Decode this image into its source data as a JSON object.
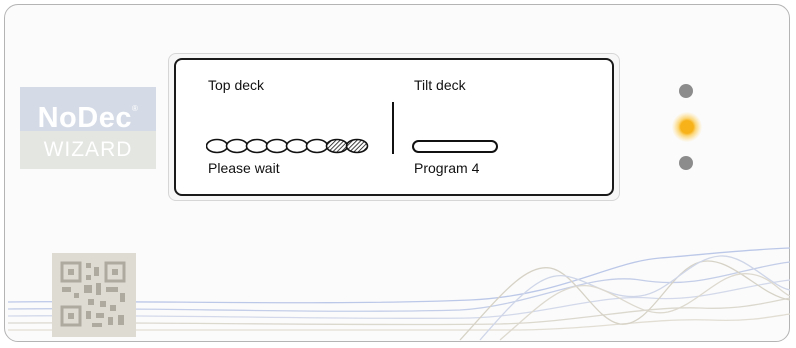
{
  "logo": {
    "brand": "NoDec",
    "mark": "®",
    "subtitle": "WIZARD"
  },
  "display": {
    "left_title": "Top deck",
    "left_status": "Please wait",
    "right_title": "Tilt deck",
    "right_status": "Program 4"
  },
  "progress": {
    "segments_total": 8,
    "segments_filled": 2
  },
  "indicators": [
    {
      "name": "indicator-top",
      "state": "off",
      "color": "#8c8c8c"
    },
    {
      "name": "indicator-middle",
      "state": "on",
      "color": "#f7b21a"
    },
    {
      "name": "indicator-bottom",
      "state": "off",
      "color": "#8c8c8c"
    }
  ],
  "colors": {
    "brand_panel": "#d5dbe6",
    "wizard_panel": "#e3e6e1",
    "display_border": "#1a1a1a",
    "led_active": "#f7b21a"
  },
  "icons": [
    "qr-code-icon",
    "progress-segments-icon"
  ]
}
